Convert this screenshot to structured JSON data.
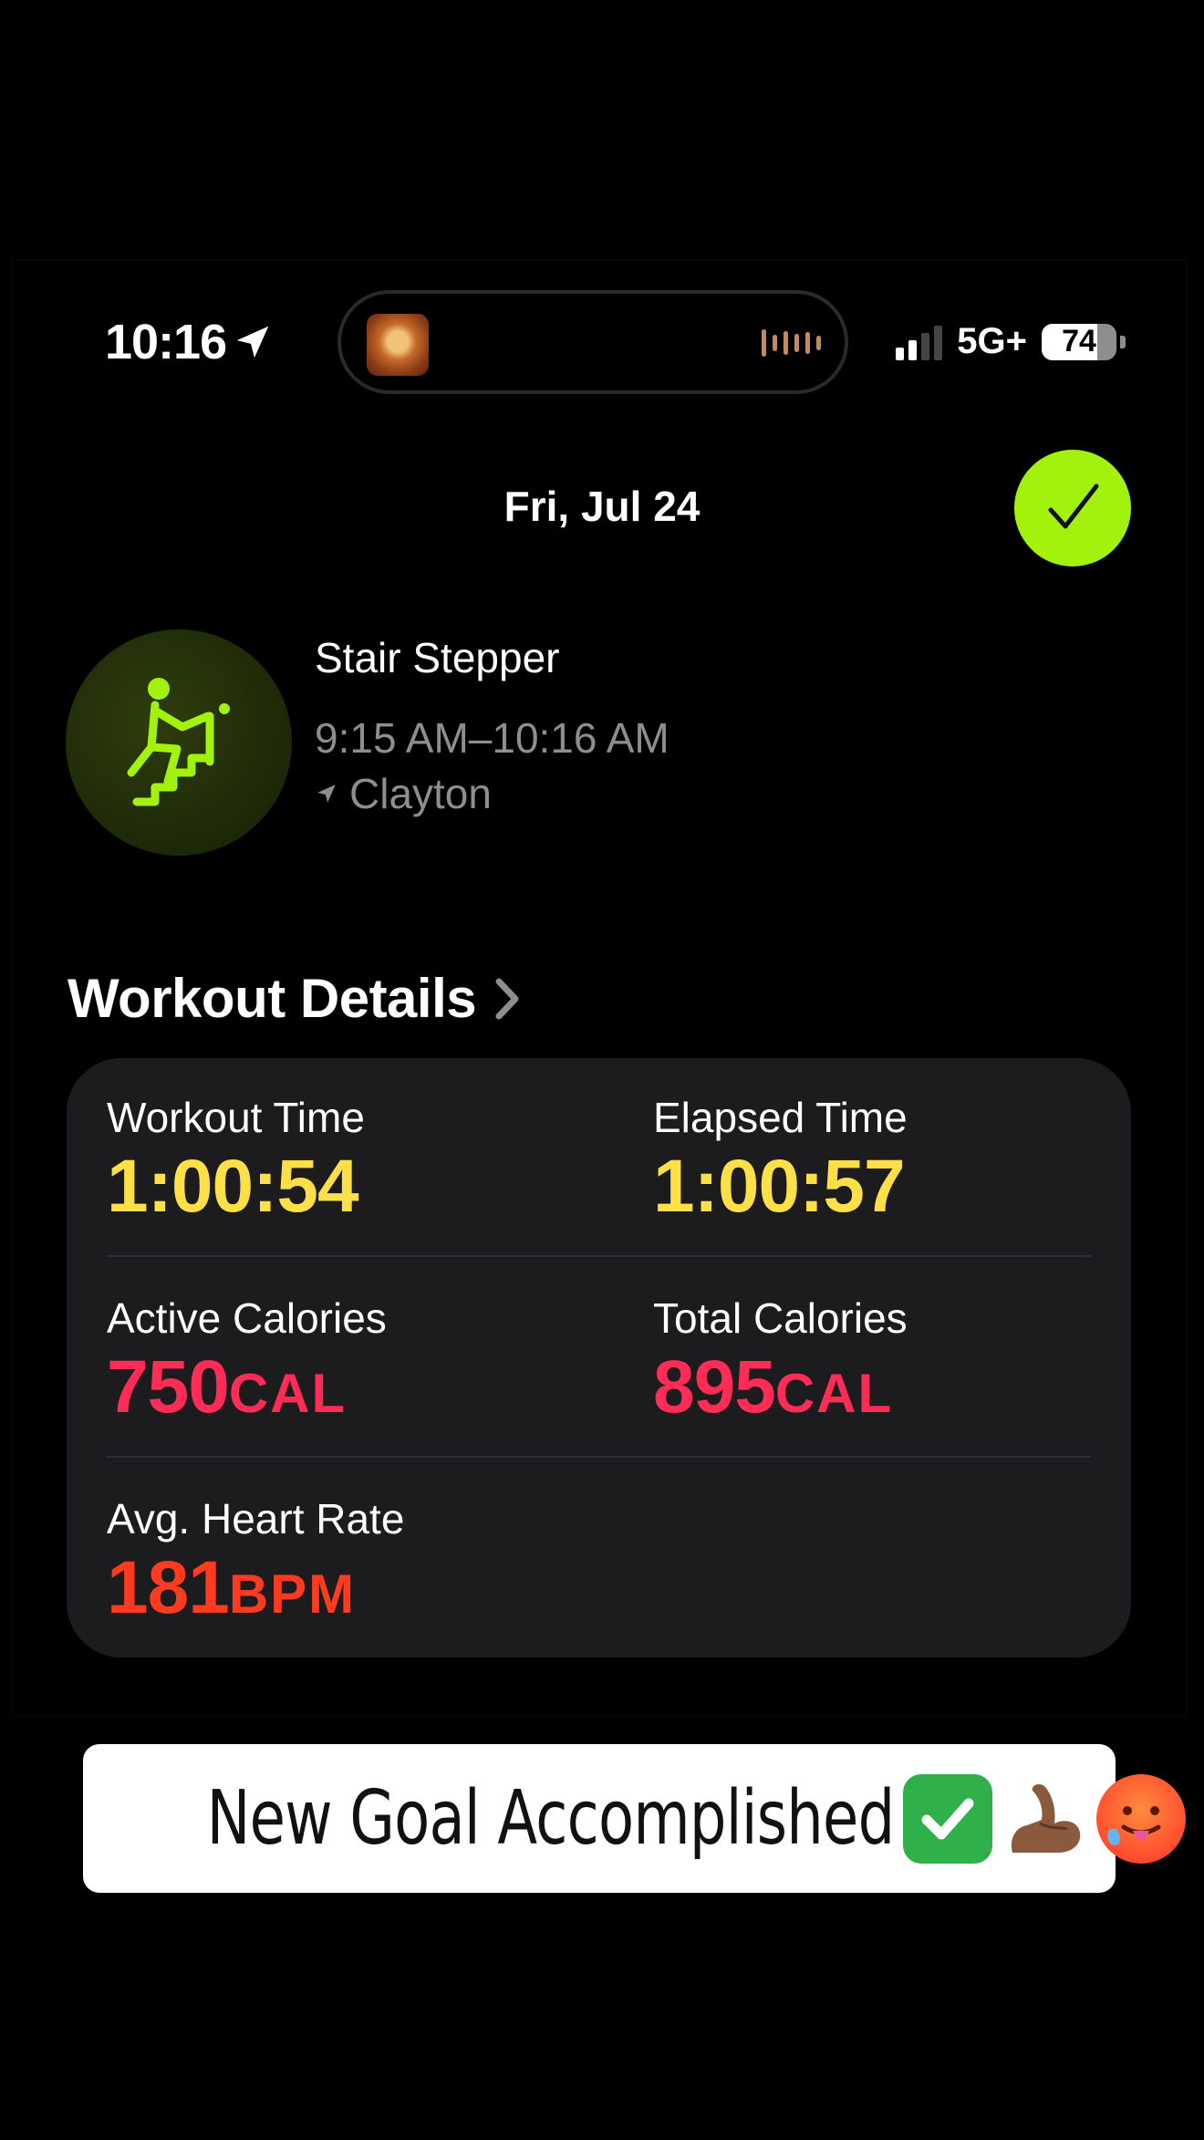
{
  "status_bar": {
    "time": "10:16",
    "network": "5G+",
    "battery_level": "74",
    "battery_fraction": 0.74
  },
  "header": {
    "date": "Fri, Jul 24"
  },
  "workout": {
    "name": "Stair Stepper",
    "timespan": "9:15 AM–10:16 AM",
    "location": "Clayton"
  },
  "details": {
    "section_title": "Workout Details",
    "metrics": [
      {
        "label": "Workout Time",
        "value": "1:00:54",
        "unit": "",
        "color": "#fde047"
      },
      {
        "label": "Elapsed Time",
        "value": "1:00:57",
        "unit": "",
        "color": "#fde047"
      },
      {
        "label": "Active Calories",
        "value": "750",
        "unit": "CAL",
        "color": "#ff2d55"
      },
      {
        "label": "Total Calories",
        "value": "895",
        "unit": "CAL",
        "color": "#ff2d55"
      },
      {
        "label": "Avg. Heart Rate",
        "value": "181",
        "unit": "BPM",
        "color": "#ff3b1f"
      }
    ]
  },
  "caption": {
    "text": "New Goal Accomplished",
    "emojis": [
      "check-mark-emoji",
      "flexed-biceps-emoji",
      "hot-face-emoji"
    ]
  },
  "colors": {
    "accent_green": "#a2f20d",
    "card_bg": "#1c1c1e",
    "secondary_text": "#8d8d92"
  }
}
